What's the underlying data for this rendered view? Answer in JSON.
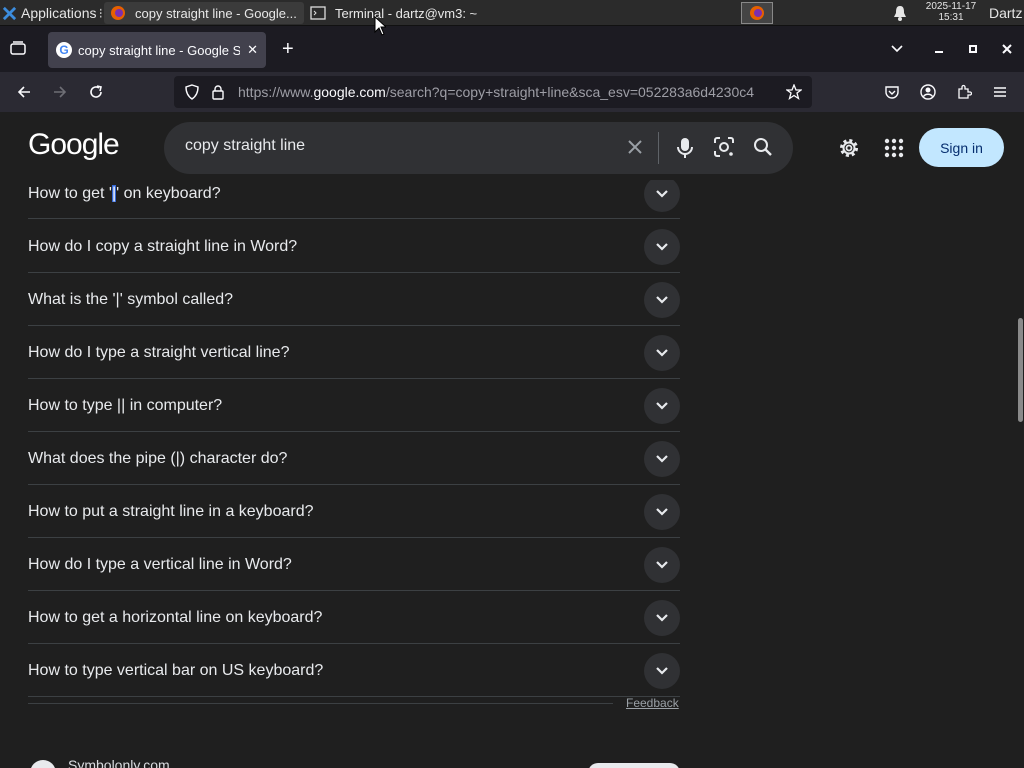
{
  "taskbar": {
    "apps_label": "Applications",
    "tasks": [
      {
        "label": "copy straight line - Google..."
      },
      {
        "label": "Terminal - dartz@vm3: ~"
      }
    ],
    "clock_date": "2025-11-17",
    "clock_time": "15:31",
    "user": "Dartz"
  },
  "browser": {
    "tab_title": "copy straight line - Google Search",
    "url_prefix": "https://www.",
    "url_domain": "google.com",
    "url_rest": "/search?q=copy+straight+line&sca_esv=052283a6d4230c4",
    "colors": {
      "tab_active": "#42414d",
      "toolbar": "#2b2a33"
    }
  },
  "google": {
    "logo": "Google",
    "query": "copy straight line",
    "signin_label": "Sign in",
    "colors": {
      "signin_bg": "#c2e7ff",
      "search_bg": "#303134"
    }
  },
  "questions": {
    "first_prefix": "How to get '",
    "first_highlight": "|",
    "first_suffix": "' on keyboard?",
    "items": [
      "How do I copy a straight line in Word?",
      "What is the '|' symbol called?",
      "How do I type a straight vertical line?",
      "How to type || in computer?",
      "What does the pipe (|) character do?",
      "How to put a straight line in a keyboard?",
      "How do I type a vertical line in Word?",
      "How to get a horizontal line on keyboard?",
      "How to type vertical bar on US keyboard?"
    ]
  },
  "feedback_label": "Feedback",
  "result": {
    "site_name": "Symbolonly.com"
  }
}
